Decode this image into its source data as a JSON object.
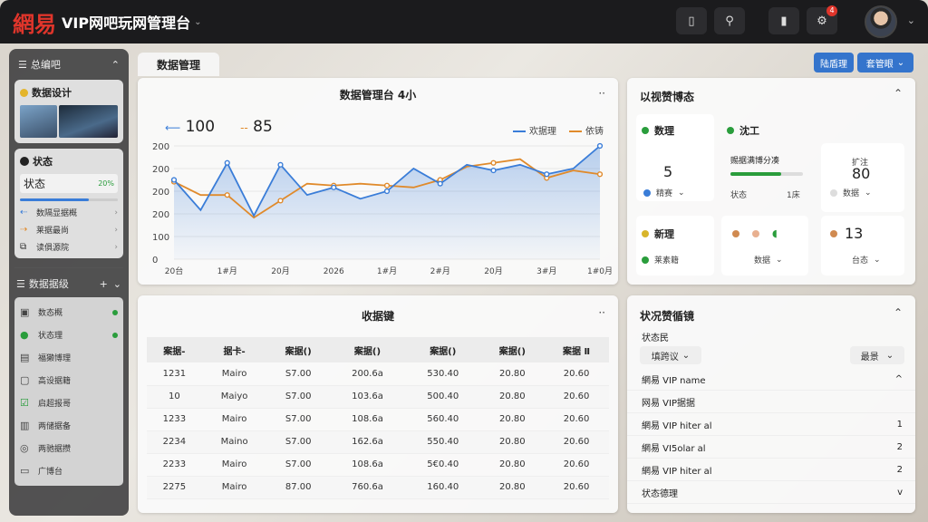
{
  "app": {
    "logo": "網易",
    "title": "VIP网吧玩网管理台"
  },
  "topbar": {
    "notif_count": "4"
  },
  "sidebar": {
    "header": "总编吧",
    "card1_title": "数据设计",
    "card2_title": "状态",
    "card2_state_label": "状态",
    "card2_state_pct": "20%",
    "card2_progress": 0.7,
    "card2_items": [
      {
        "label": "数隔显据概",
        "icon": "arrow-left-icon"
      },
      {
        "label": "莱据最尚",
        "icon": "trend-icon"
      },
      {
        "label": "读俱源院",
        "icon": "copy-icon"
      }
    ],
    "section2_title": "数据据级",
    "menu_header": "数态概",
    "menu_items": [
      {
        "label": "状态理",
        "icon": "status-icon"
      },
      {
        "label": "福獭博理",
        "icon": "list-icon"
      },
      {
        "label": "高设据籍",
        "icon": "doc-icon"
      },
      {
        "label": "启超报哥",
        "icon": "check-icon"
      },
      {
        "label": "两储据备",
        "icon": "file-icon"
      },
      {
        "label": "两驰据攒",
        "icon": "globe-icon"
      },
      {
        "label": "广博台",
        "icon": "window-icon"
      }
    ]
  },
  "main": {
    "tab_label": "数据管理",
    "btn1": "陆盾理",
    "btn2": "套管眼"
  },
  "chart_panel": {
    "title": "数据管理台 4小",
    "legend_val1": "100",
    "legend_val2": "85",
    "series1_name": "欢据理",
    "series2_name": "依铸"
  },
  "chart_data": {
    "type": "line",
    "x": [
      "20台",
      "",
      "1#月",
      "",
      "20月",
      "",
      "2026",
      "",
      "1#月",
      "",
      "2#月",
      "",
      "20月",
      "",
      "3#月",
      "",
      "1#0月"
    ],
    "series": [
      {
        "name": "欢据理",
        "values": [
          210,
          130,
          255,
          115,
          250,
          170,
          190,
          160,
          180,
          240,
          200,
          250,
          235,
          250,
          225,
          240,
          300
        ]
      },
      {
        "name": "依铸",
        "values": [
          205,
          170,
          170,
          110,
          155,
          200,
          195,
          200,
          195,
          190,
          210,
          245,
          255,
          265,
          215,
          235,
          225
        ]
      }
    ],
    "yticks": [
      "200",
      "200",
      "200",
      "200",
      "100",
      "0"
    ],
    "xticks": [
      "20台",
      "1#月",
      "20月",
      "2026",
      "1#月",
      "2#月",
      "20月",
      "3#月",
      "1#0月"
    ],
    "colors": {
      "series1": "#3a7dd8",
      "series2": "#e08a2b"
    },
    "ylim": [
      0,
      300
    ],
    "grid": true,
    "legend": "top-right",
    "title": ""
  },
  "stats_panel": {
    "title": "以视赞博态",
    "cards": {
      "a_label": "数理",
      "a_value": "5",
      "a_sub": "精赛",
      "b_label": "沈工",
      "b_desc": "赐据满博分凑",
      "b_sub1": "状态",
      "b_sub2": "1床",
      "b_progress": 0.7,
      "c_top": "扩注",
      "c_value": "80",
      "c_sub": "数据",
      "d_label": "新理",
      "d_sub": "莱素籍",
      "e_sub": "数据",
      "f_value": "13",
      "f_sub": "台态"
    }
  },
  "table_panel": {
    "title": "收据键",
    "headers": [
      "案据-",
      "据卡-",
      "案据()",
      "案据()",
      "案据()",
      "案据()",
      "案据 Ⅱ"
    ],
    "rows": [
      [
        "1231",
        "Mairo",
        "S7.00",
        "200.6a",
        "530.40",
        "20.80",
        "20.60"
      ],
      [
        "10",
        "Maiyo",
        "S7.00",
        "103.6a",
        "500.40",
        "20.80",
        "20.60"
      ],
      [
        "1233",
        "Mairo",
        "S7.00",
        "108.6a",
        "560.40",
        "20.80",
        "20.60"
      ],
      [
        "2234",
        "Maino",
        "S7.00",
        "162.6a",
        "550.40",
        "20.80",
        "20.60"
      ],
      [
        "2233",
        "Mairo",
        "S7.00",
        "108.6a",
        "5€0.40",
        "20.80",
        "20.60"
      ],
      [
        "2275",
        "Mairo",
        "87.00",
        "760.6a",
        "160.40",
        "20.80",
        "20.60"
      ]
    ]
  },
  "list_panel": {
    "title": "状况赞循镜",
    "filter_label": "状态民",
    "select1": "填跨议",
    "select2": "最景",
    "rows": [
      {
        "label": "網易 VIP name",
        "val": "^"
      },
      {
        "label": "网易 VIP据据",
        "val": ""
      },
      {
        "label": "網易 VIP hiter al",
        "val": "1"
      },
      {
        "label": "網易 VI5olar al",
        "val": "2"
      },
      {
        "label": "網易 VIP hiter al",
        "val": "2"
      },
      {
        "label": "状态德理",
        "val": "v"
      }
    ]
  }
}
